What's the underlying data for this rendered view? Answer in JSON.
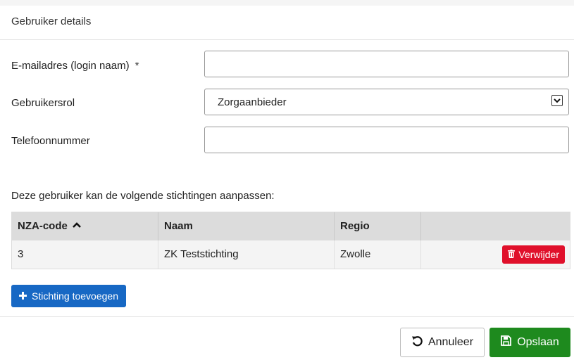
{
  "panel": {
    "title": "Gebruiker details"
  },
  "form": {
    "email": {
      "label": "E-mailadres (login naam)",
      "required_marker": "*",
      "value": ""
    },
    "role": {
      "label": "Gebruikersrol",
      "value": "Zorgaanbieder"
    },
    "phone": {
      "label": "Telefoonnummer",
      "value": ""
    }
  },
  "foundations": {
    "intro": "Deze gebruiker kan de volgende stichtingen aanpassen:",
    "columns": [
      "NZA-code",
      "Naam",
      "Regio",
      ""
    ],
    "sort_icon": "chevron-up-icon",
    "rows": [
      {
        "code": "3",
        "name": "ZK Teststichting",
        "region": "Zwolle",
        "delete_label": "Verwijder"
      }
    ],
    "add_label": "Stichting toevoegen"
  },
  "footer": {
    "cancel_label": "Annuleer",
    "save_label": "Opslaan"
  },
  "colors": {
    "delete": "#e0102b",
    "add": "#1768c4",
    "save": "#1e8a1e"
  }
}
